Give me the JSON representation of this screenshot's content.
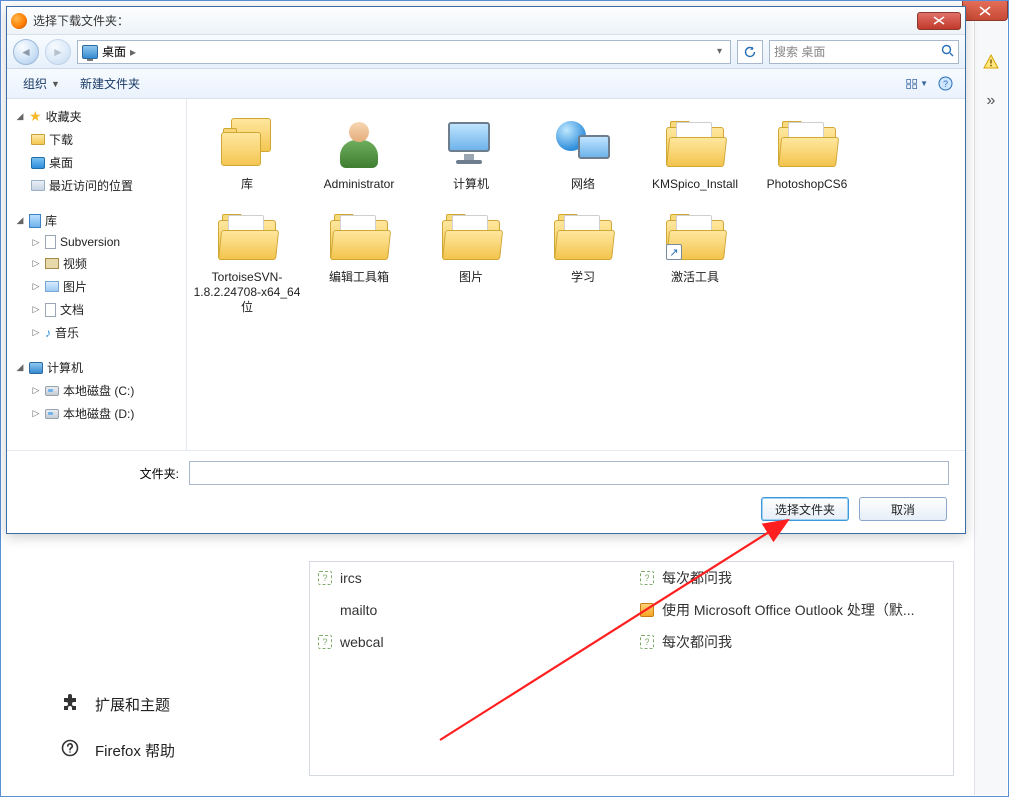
{
  "dialog": {
    "title": "选择下载文件夹：",
    "address": {
      "location": "桌面"
    },
    "search_placeholder": "搜索 桌面",
    "toolbar": {
      "organize": "组织",
      "newfolder": "新建文件夹"
    },
    "tree": {
      "favorites": {
        "label": "收藏夹",
        "items": [
          "下载",
          "桌面",
          "最近访问的位置"
        ]
      },
      "libraries": {
        "label": "库",
        "items": [
          "Subversion",
          "视频",
          "图片",
          "文档",
          "音乐"
        ]
      },
      "computer": {
        "label": "计算机",
        "items": [
          "本地磁盘 (C:)",
          "本地磁盘 (D:)"
        ]
      }
    },
    "items": [
      {
        "name": "库",
        "kind": "libraries"
      },
      {
        "name": "Administrator",
        "kind": "user"
      },
      {
        "name": "计算机",
        "kind": "computer"
      },
      {
        "name": "网络",
        "kind": "network"
      },
      {
        "name": "KMSpico_Install",
        "kind": "folder"
      },
      {
        "name": "PhotoshopCS6",
        "kind": "folder"
      },
      {
        "name": "TortoiseSVN-1.8.2.24708-x64_64位",
        "kind": "folder"
      },
      {
        "name": "编辑工具箱",
        "kind": "folder"
      },
      {
        "name": "图片",
        "kind": "folder"
      },
      {
        "name": "学习",
        "kind": "folder"
      },
      {
        "name": "激活工具",
        "kind": "folder",
        "shortcut": true
      }
    ],
    "folder_label": "文件夹:",
    "folder_value": "",
    "buttons": {
      "select": "选择文件夹",
      "cancel": "取消"
    }
  },
  "background": {
    "sidebar": {
      "extensions": "扩展和主题",
      "help": "Firefox 帮助"
    },
    "apps": [
      {
        "proto": "ircs",
        "handler": "每次都问我"
      },
      {
        "proto": "mailto",
        "handler": "使用 Microsoft Office Outlook 处理（默..."
      },
      {
        "proto": "webcal",
        "handler": "每次都问我"
      }
    ]
  }
}
